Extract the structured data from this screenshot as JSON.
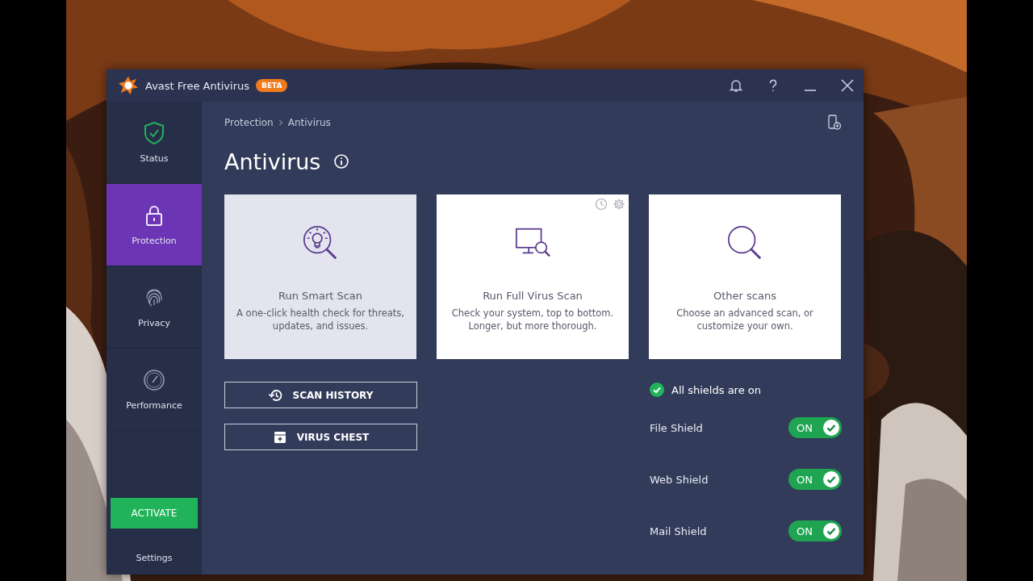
{
  "window": {
    "title": "Avast Free Antivirus",
    "badge": "BETA"
  },
  "sidebar": {
    "items": [
      {
        "label": "Status",
        "kind": "shield",
        "selected": false
      },
      {
        "label": "Protection",
        "kind": "lock",
        "selected": true
      },
      {
        "label": "Privacy",
        "kind": "fingerprint",
        "selected": false
      },
      {
        "label": "Performance",
        "kind": "gauge",
        "selected": false
      }
    ],
    "activate_button": "ACTIVATE",
    "settings": "Settings"
  },
  "breadcrumb": [
    "Protection",
    "Antivirus"
  ],
  "page_title": "Antivirus",
  "scan_cards": [
    {
      "kind": "bulb",
      "title": "Run Smart Scan",
      "description": "A one-click health check for threats, updates, and issues.",
      "highlighted": true,
      "has_options": false
    },
    {
      "kind": "monitor",
      "title": "Run Full Virus Scan",
      "description": "Check your system, top to bottom. Longer, but more thorough.",
      "highlighted": false,
      "has_options": true
    },
    {
      "kind": "search",
      "title": "Other scans",
      "description": "Choose an advanced scan, or customize your own.",
      "highlighted": false,
      "has_options": false
    }
  ],
  "buttons": [
    {
      "label": "SCAN HISTORY",
      "kind": "history"
    },
    {
      "label": "VIRUS CHEST",
      "kind": "chest"
    }
  ],
  "shields_status": "All shields are on",
  "shields": [
    {
      "name": "File Shield",
      "on": true,
      "state_label": "ON"
    },
    {
      "name": "Web Shield",
      "on": true,
      "state_label": "ON"
    },
    {
      "name": "Mail Shield",
      "on": true,
      "state_label": "ON"
    }
  ]
}
